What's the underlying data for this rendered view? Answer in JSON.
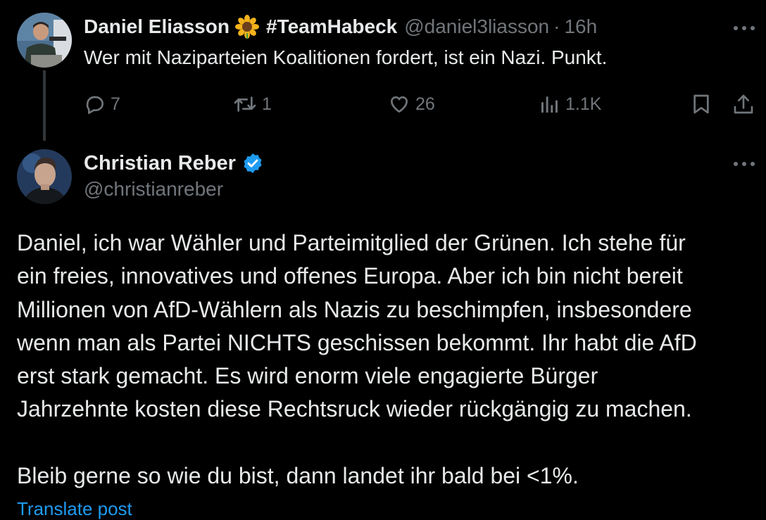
{
  "reply_tweet": {
    "display_name": "Daniel Eliasson",
    "name_emoji": "sunflower",
    "hashtag": "#TeamHabeck",
    "handle": "@daniel3liasson",
    "separator": "·",
    "time": "16h",
    "text": "Wer mit Naziparteien Koalitionen fordert, ist ein Nazi. Punkt.",
    "actions": {
      "replies": "7",
      "retweets": "1",
      "likes": "26",
      "views": "1.1K"
    }
  },
  "main_tweet": {
    "display_name": "Christian Reber",
    "verified": true,
    "handle": "@christianreber",
    "body_lines": [
      "Daniel, ich war Wähler und Parteimitglied der Grünen. Ich stehe für",
      "ein freies, innovatives und offenes Europa. Aber ich bin nicht bereit",
      "Millionen von AfD-Wählern als Nazis zu beschimpfen, insbesondere",
      "wenn man als Partei NICHTS geschissen bekommt. Ihr habt die AfD",
      "erst stark gemacht. Es wird enorm viele engagierte Bürger",
      "Jahrzehnte kosten diese Rechtsruck wieder rückgängig zu machen."
    ],
    "body_last_line": "Bleib gerne so wie du bist, dann landet ihr bald bei <1%.",
    "translate_label": "Translate post"
  },
  "colors": {
    "background": "#000000",
    "text_primary": "#e7e9ea",
    "text_secondary": "#71767b",
    "accent": "#1d9bf0",
    "thread_line": "#333639"
  },
  "icons": {
    "reply": "speech-bubble-icon",
    "retweet": "retweet-icon",
    "like": "heart-icon",
    "views": "bar-chart-icon",
    "bookmark": "bookmark-icon",
    "share": "share-icon",
    "more": "more-horizontal-icon",
    "verified": "verified-badge-icon"
  }
}
